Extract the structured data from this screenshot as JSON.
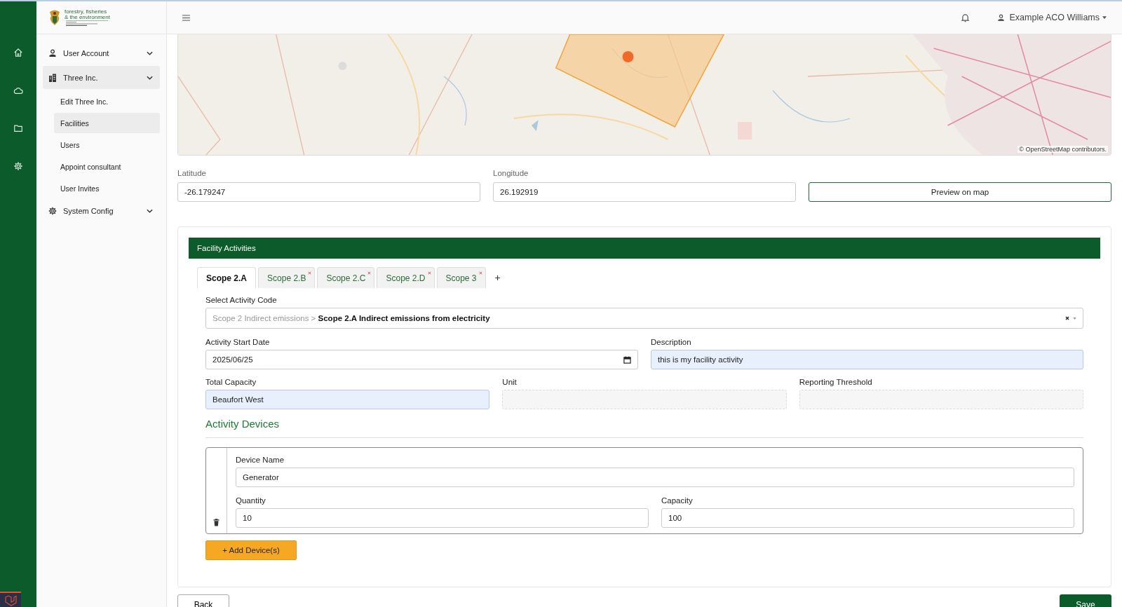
{
  "logo": {
    "line_1": "forestry, fisheries",
    "line_2": "& the environment"
  },
  "sidebar": {
    "items": [
      {
        "label": "User Account",
        "selected": false
      },
      {
        "label": "Three Inc.",
        "selected": true,
        "children": [
          {
            "label": "Edit Three Inc.",
            "selected": false
          },
          {
            "label": "Facilities",
            "selected": true
          },
          {
            "label": "Users",
            "selected": false
          },
          {
            "label": "Appoint consultant",
            "selected": false
          },
          {
            "label": "User Invites",
            "selected": false
          }
        ]
      },
      {
        "label": "System Config",
        "selected": false
      }
    ]
  },
  "header": {
    "user": "Example ACO Williams"
  },
  "map": {
    "attribution": "© OpenStreetMap contributors."
  },
  "location": {
    "latitude": {
      "label": "Latitude",
      "value": "-26.179247"
    },
    "longitude": {
      "label": "Longitude",
      "value": "26.192919"
    },
    "preview_button": "Preview on map"
  },
  "activities": {
    "title": "Facility Activities",
    "tabs": [
      {
        "label": "Scope 2.A",
        "selected": true,
        "closable": false
      },
      {
        "label": "Scope 2.B",
        "selected": false,
        "closable": true
      },
      {
        "label": "Scope 2.C",
        "selected": false,
        "closable": true
      },
      {
        "label": "Scope 2.D",
        "selected": false,
        "closable": true
      },
      {
        "label": "Scope 3",
        "selected": false,
        "closable": true
      }
    ],
    "add_tab": "+",
    "activity_code": {
      "label": "Select Activity Code",
      "path": "Scope 2 Indirect emissions >",
      "value": "Scope 2.A Indirect emissions from electricity"
    },
    "start_date": {
      "label": "Activity Start Date",
      "value": "2025/06/25"
    },
    "row_fields": [
      {
        "label": "Description",
        "value": "this is my facility activity",
        "highlighted": true,
        "disabled": false
      }
    ],
    "capacity_fields": [
      {
        "label": "Total Capacity",
        "value": "Beaufort West",
        "highlighted": true,
        "disabled": false
      },
      {
        "label": "Unit",
        "highlighted": false,
        "disabled": true
      },
      {
        "label": "Reporting Threshold",
        "highlighted": false,
        "disabled": true
      }
    ],
    "devices_title": "Activity Devices",
    "devices": [
      {
        "name": {
          "label": "Device Name",
          "value": "Generator"
        },
        "quantity": {
          "label": "Quantity",
          "value": "10"
        },
        "capacity": {
          "label": "Capacity",
          "value": "100"
        }
      }
    ],
    "add_device": "+ Add Device(s)"
  },
  "footer": {
    "back": "Back",
    "save": "Save"
  }
}
